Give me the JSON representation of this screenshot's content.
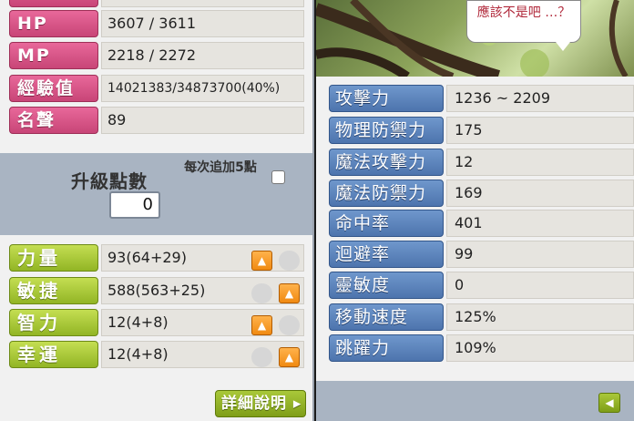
{
  "basic_stats": [
    {
      "label": "HP",
      "value": "3607 / 3611"
    },
    {
      "label": "MP",
      "value": "2218 / 2272"
    },
    {
      "label": "經驗值",
      "value": "14021383/34873700(40%)"
    },
    {
      "label": "名聲",
      "value": "89"
    }
  ],
  "ability_points": {
    "label": "升級點數",
    "value": "0",
    "auto_add_label": "每次追加5點",
    "auto_add_checked": false
  },
  "attributes": [
    {
      "label": "力量",
      "value": "93(64+29)"
    },
    {
      "label": "敏捷",
      "value": "588(563+25)"
    },
    {
      "label": "智力",
      "value": "12(4+8)"
    },
    {
      "label": "幸運",
      "value": "12(4+8)"
    }
  ],
  "detail_button_label": "詳細說明",
  "speech_bubble": "應該不是吧 …？",
  "detail_stats": [
    {
      "label": "攻擊力",
      "value": "1236 ~ 2209"
    },
    {
      "label": "物理防禦力",
      "value": "175"
    },
    {
      "label": "魔法攻擊力",
      "value": "12"
    },
    {
      "label": "魔法防禦力",
      "value": "169"
    },
    {
      "label": "命中率",
      "value": "401"
    },
    {
      "label": "迴避率",
      "value": "99"
    },
    {
      "label": "靈敏度",
      "value": "0"
    },
    {
      "label": "移動速度",
      "value": "125%"
    },
    {
      "label": "跳躍力",
      "value": "109%"
    }
  ],
  "icons": {
    "plus": "plus-arrow-icon",
    "back": "back-arrow-icon"
  },
  "colors": {
    "basic_label": "#d4507f",
    "attribute_label": "#a6c53a",
    "detail_label": "#5b82bb",
    "plus_button": "#f39a1f"
  }
}
